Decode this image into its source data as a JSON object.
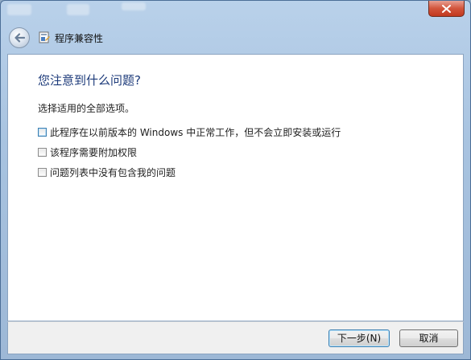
{
  "window": {
    "title": "程序兼容性"
  },
  "main": {
    "heading": "您注意到什么问题?",
    "instruction": "选择适用的全部选项。",
    "options": [
      {
        "label": "此程序在以前版本的 Windows 中正常工作，但不会立即安装或运行",
        "checked": false
      },
      {
        "label": "该程序需要附加权限",
        "checked": false
      },
      {
        "label": "问题列表中没有包含我的问题",
        "checked": false
      }
    ]
  },
  "footer": {
    "next_label": "下一步(N)",
    "cancel_label": "取消"
  },
  "icons": {
    "close": "close-icon",
    "back": "back-arrow-icon",
    "app": "program-compatibility-icon"
  },
  "colors": {
    "heading": "#1c3a7a",
    "close_button": "#c2391f",
    "frame": "#a8c3e0"
  }
}
